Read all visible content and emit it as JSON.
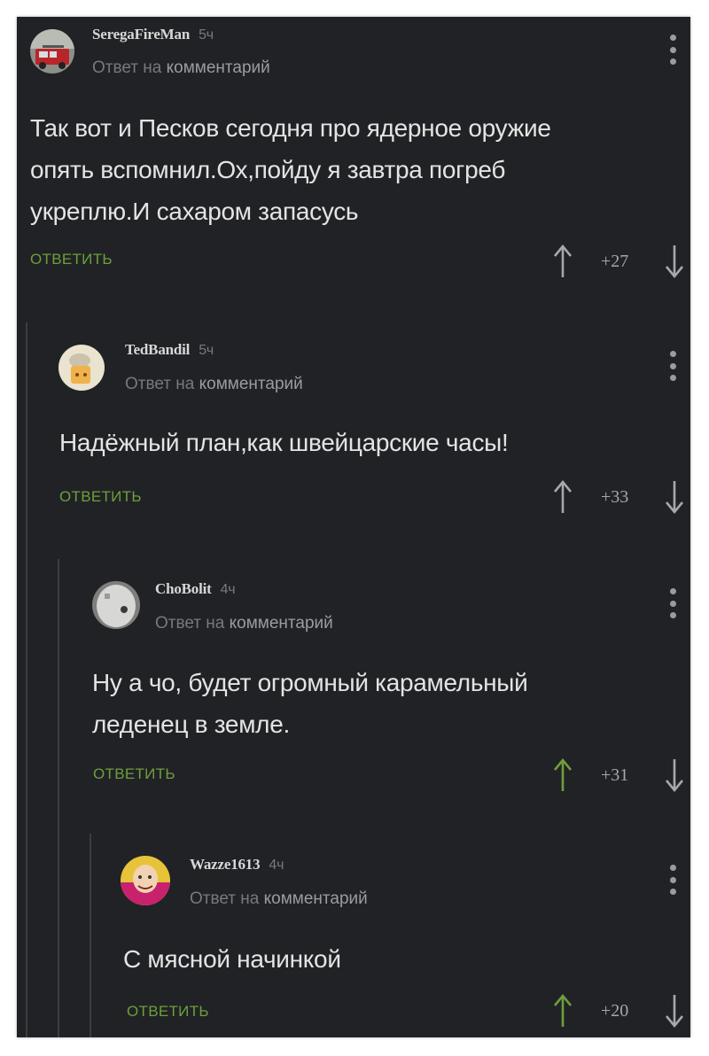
{
  "comments": [
    {
      "username": "SeregaFireMan",
      "time": "5ч",
      "reply_prefix": "Ответ на",
      "reply_target": "комментарий",
      "lines": [
        "Так вот и Песков сегодня про ядерное оружие",
        "опять вспомнил.Ох,пойду я завтра погреб",
        "укреплю.И сахаром запасусь"
      ],
      "reply_label": "ОТВЕТИТЬ",
      "score": "+27",
      "upvoted": false
    },
    {
      "username": "TedBandil",
      "time": "5ч",
      "reply_prefix": "Ответ на",
      "reply_target": "комментарий",
      "lines": [
        "Надёжный план,как швейцарские часы!"
      ],
      "reply_label": "ОТВЕТИТЬ",
      "score": "+33",
      "upvoted": false
    },
    {
      "username": "ChoBolit",
      "time": "4ч",
      "reply_prefix": "Ответ на",
      "reply_target": "комментарий",
      "lines": [
        "Ну а чо, будет огромный карамельный",
        "леденец в земле."
      ],
      "reply_label": "ОТВЕТИТЬ",
      "score": "+31",
      "upvoted": true
    },
    {
      "username": "Wazze1613",
      "time": "4ч",
      "reply_prefix": "Ответ на",
      "reply_target": "комментарий",
      "lines": [
        "С мясной начинкой"
      ],
      "reply_label": "ОТВЕТИТЬ",
      "score": "+20",
      "upvoted": true
    }
  ],
  "colors": {
    "background": "#212225",
    "reply_button": "#6d9f3c",
    "upvote_active": "#6d9f3c",
    "vote_inactive": "#a6a8ad",
    "text": "#e4e4e4"
  },
  "icons": [
    "more-vertical-icon",
    "arrow-up-icon",
    "arrow-down-icon"
  ]
}
